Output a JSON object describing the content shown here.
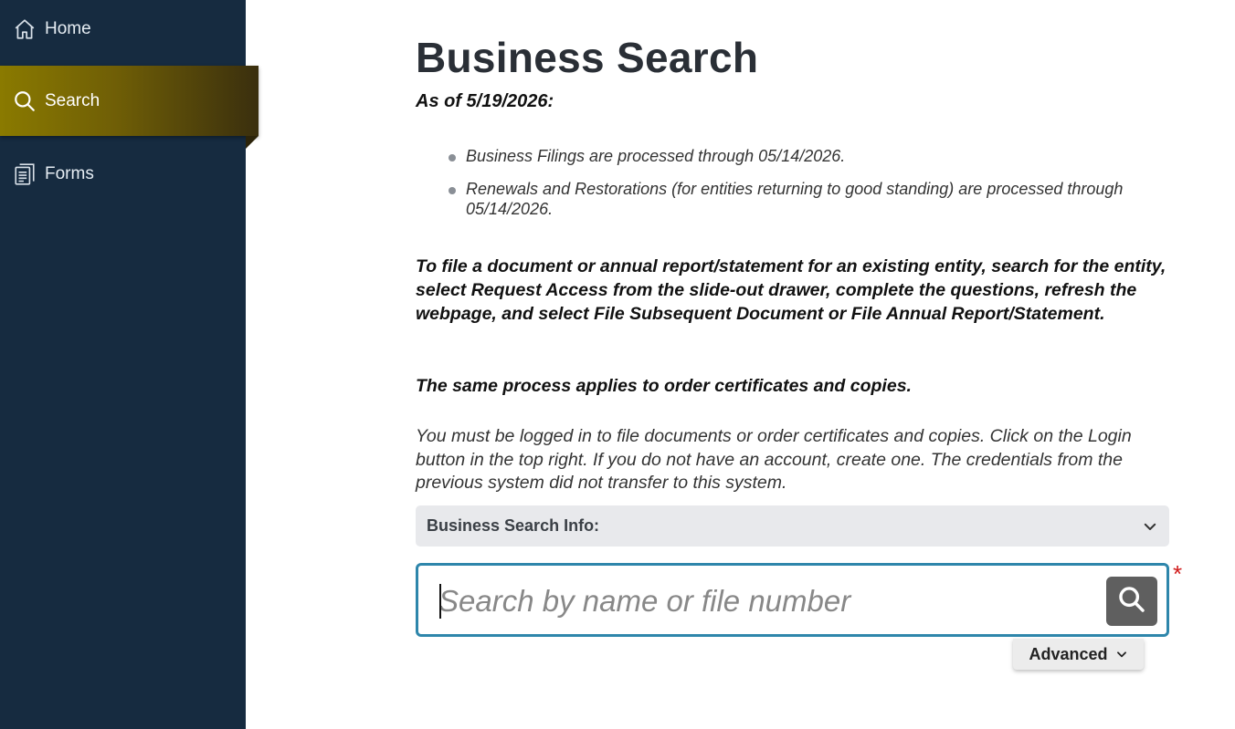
{
  "sidebar": {
    "items": [
      {
        "label": "Home",
        "icon": "home-icon",
        "active": false
      },
      {
        "label": "Search",
        "icon": "search-icon",
        "active": true
      },
      {
        "label": "Forms",
        "icon": "forms-icon",
        "active": false
      }
    ]
  },
  "main": {
    "title": "Business Search",
    "as_of": "As of 5/19/2026:",
    "bullets": [
      "Business Filings are processed through 05/14/2026.",
      "Renewals and Restorations (for entities returning to good standing) are processed through 05/14/2026."
    ],
    "instruction": "To file a document or annual report/statement for an existing entity, search for the entity, select Request Access from the slide-out drawer, complete the questions, refresh the webpage, and select File Subsequent Document or File Annual Report/Statement.",
    "same_process": "The same process applies to order certificates and copies.",
    "login_note": "You must be logged in to file documents or order certificates and copies. Click on the Login button in the top right. If you do not have an account, create one. The credentials from the previous system did not transfer to this system.",
    "info_bar_label": "Business Search Info:",
    "search": {
      "placeholder": "Search by name or file number",
      "value": "",
      "required_mark": "*"
    },
    "advanced_label": "Advanced"
  },
  "colors": {
    "sidebar_bg": "#162b40",
    "active_gold": "#8a7a00",
    "search_border": "#2e86ab",
    "required": "#d11a1a"
  }
}
